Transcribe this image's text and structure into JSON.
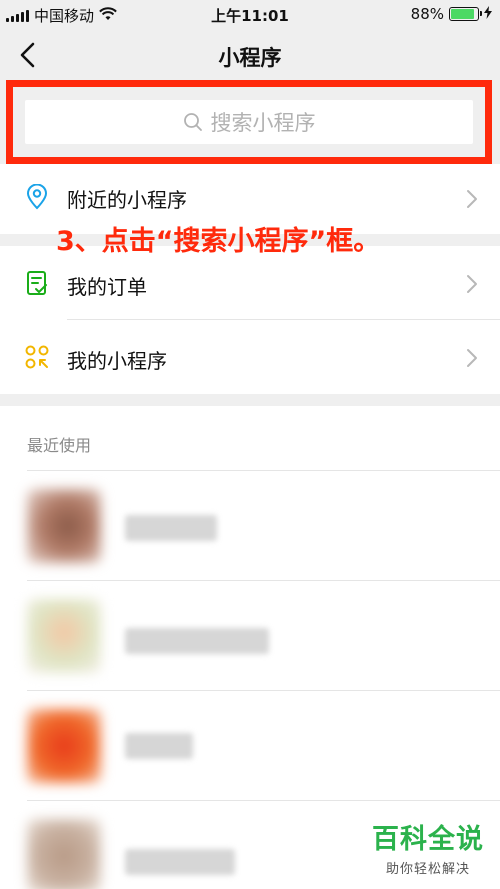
{
  "status_bar": {
    "carrier": "中国移动",
    "time": "上午11:01",
    "battery_percent": "88%",
    "battery_level": 0.88,
    "battery_color": "#4cd964"
  },
  "nav": {
    "title": "小程序",
    "back_icon": "chevron-left-icon"
  },
  "search": {
    "placeholder": "搜索小程序",
    "icon": "search-icon",
    "highlight_color": "#ff2a0c"
  },
  "menu": [
    {
      "label": "附近的小程序",
      "icon": "location-pin-icon",
      "icon_color": "#1aa3e8"
    },
    {
      "label": "我的订单",
      "icon": "order-list-icon",
      "icon_color": "#1aad19"
    },
    {
      "label": "我的小程序",
      "icon": "mini-program-grid-icon",
      "icon_color": "#f2b600"
    }
  ],
  "annotation": "3、点击“搜索小程序”框。",
  "recent": {
    "title": "最近使用"
  },
  "watermark": {
    "title": "百科全说",
    "subtitle": "助你轻松解决"
  }
}
